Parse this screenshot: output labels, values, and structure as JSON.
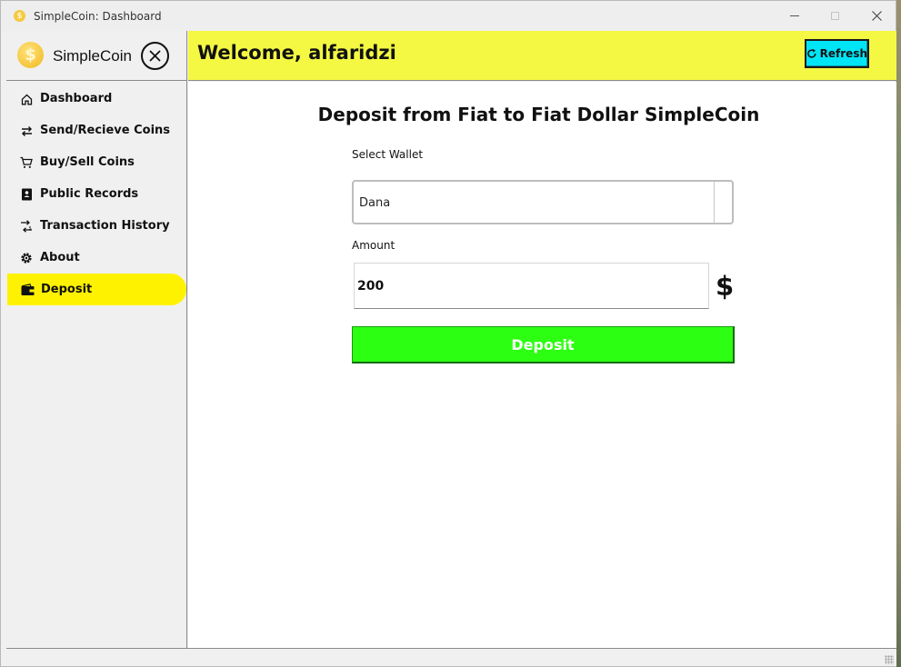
{
  "window": {
    "title": "SimpleCoin: Dashboard"
  },
  "sidebar": {
    "app_name": "SimpleCoin",
    "items": [
      {
        "label": "Dashboard",
        "icon": "home-icon"
      },
      {
        "label": "Send/Recieve Coins",
        "icon": "swap-arrows-icon"
      },
      {
        "label": "Buy/Sell Coins",
        "icon": "cart-icon"
      },
      {
        "label": "Public Records",
        "icon": "records-book-icon"
      },
      {
        "label": "Transaction History",
        "icon": "transaction-history-icon"
      },
      {
        "label": "About",
        "icon": "gear-icon"
      },
      {
        "label": "Deposit",
        "icon": "wallet-icon",
        "active": true
      }
    ]
  },
  "header": {
    "welcome": "Welcome, alfaridzi",
    "refresh_label": "Refresh"
  },
  "main": {
    "title": "Deposit from Fiat to Fiat Dollar SimpleCoin",
    "wallet_label": "Select Wallet",
    "wallet_value": "Dana",
    "amount_label": "Amount",
    "amount_value": "200",
    "currency_symbol": "$",
    "deposit_label": "Deposit"
  },
  "colors": {
    "active_nav": "#fff200",
    "header_bg": "#f4f842",
    "refresh_bg": "#00e5f5",
    "deposit_bg": "#2dff12"
  }
}
